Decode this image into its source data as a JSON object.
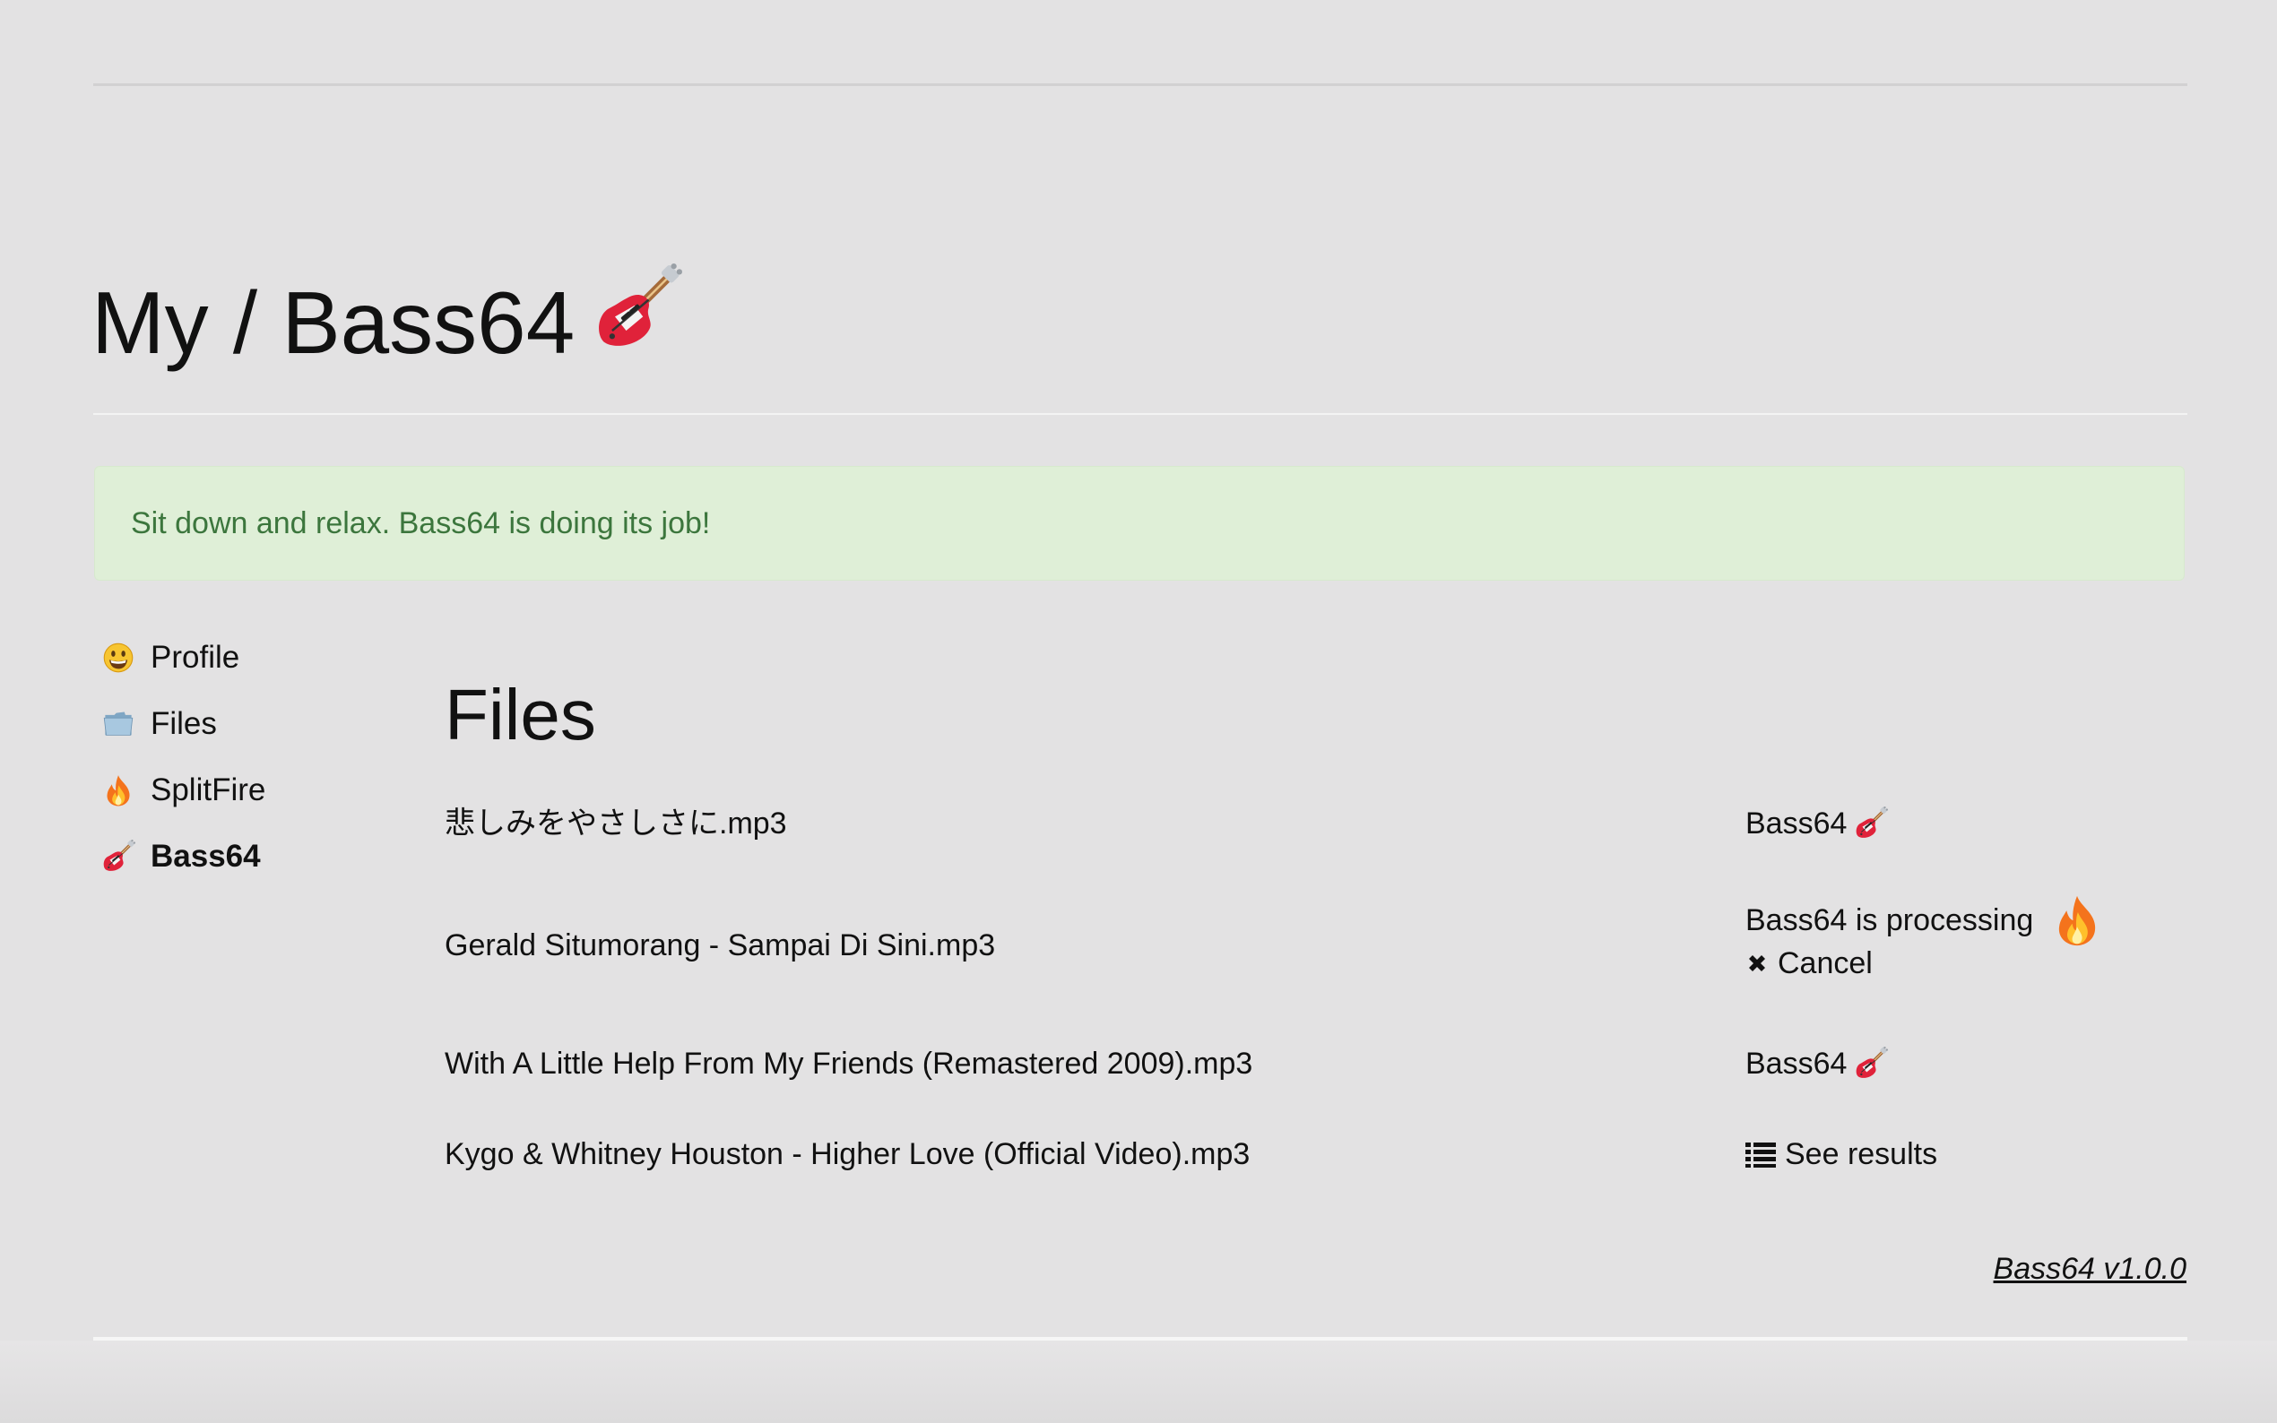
{
  "header": {
    "title": "My / Bass64",
    "title_icon": "bass-guitar-icon"
  },
  "alert": {
    "message": "Sit down and relax. Bass64 is doing its job!",
    "color": "#3c763d",
    "background": "#dfefd7"
  },
  "sidebar": {
    "items": [
      {
        "label": "Profile",
        "icon": "smiley-face-icon",
        "active": false
      },
      {
        "label": "Files",
        "icon": "folder-icon",
        "active": false
      },
      {
        "label": "SplitFire",
        "icon": "fire-icon",
        "active": false
      },
      {
        "label": "Bass64",
        "icon": "bass-guitar-icon",
        "active": true
      }
    ]
  },
  "files": {
    "heading": "Files",
    "rows": [
      {
        "name": "悲しみをやさしさに.mp3",
        "status": "Bass64",
        "status_icon": "bass-guitar-icon"
      },
      {
        "name": "Gerald Situmorang - Sampai Di Sini.mp3",
        "status": "Bass64 is processing",
        "status_icon": "fire-icon",
        "action": "Cancel",
        "action_icon": "close-icon"
      },
      {
        "name": "With A Little Help From My Friends (Remastered 2009).mp3",
        "status": "Bass64",
        "status_icon": "bass-guitar-icon"
      },
      {
        "name": "Kygo & Whitney Houston - Higher Love (Official Video).mp3",
        "action": "See results",
        "action_icon": "list-icon"
      }
    ]
  },
  "footer": {
    "version": "Bass64 v1.0.0"
  }
}
